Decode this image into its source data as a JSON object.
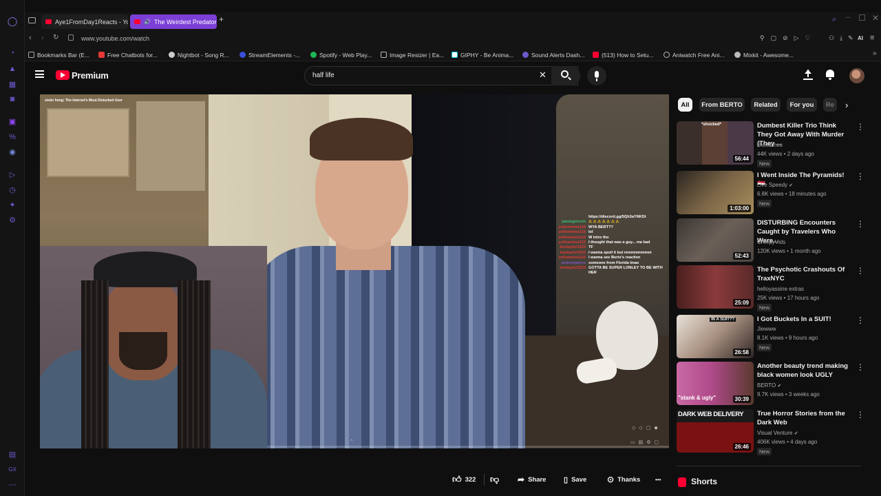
{
  "browser": {
    "tabs": [
      {
        "label": "Aye1FromDay1Reacts - Yo",
        "active": false
      },
      {
        "label": "The Weirdest Predator",
        "active": true
      }
    ],
    "new_tab": "+",
    "url": "www.youtube.com/watch",
    "ai_label": "AI",
    "bookmarks": [
      "Bookmarks Bar (E...",
      "Free Chatbots for...",
      "Nightbot - Song R...",
      "StreamElements -...",
      "Spotify - Web Play...",
      "Image Resizer | Ea...",
      "GIPHY - Be Anima...",
      "Sound Alerts Dash...",
      "(513) How to Setu...",
      "Aniwatch Free Ani...",
      "Mixkit - Awesome..."
    ]
  },
  "youtube": {
    "logo": "Premium",
    "search_value": "half life",
    "video": {
      "overlay_title": "sister hong: The Internet's Most Disturbed User",
      "chat": [
        {
          "user": "",
          "msg": "https://discord.gg/5Qh3aYNKDt"
        },
        {
          "user": "jakelagniroth",
          "msg": "⚠ ⚠ ⚠ ⚠ ⚠ ⚠ ⚠"
        },
        {
          "user": "yellowmine216",
          "msg": "WYA BERT??"
        },
        {
          "user": "yellowmine216",
          "msg": "lol"
        },
        {
          "user": "yellowmine216",
          "msg": "W intro tho"
        },
        {
          "user": "yellowmine216",
          "msg": "I thought that was a guy... ma bad"
        },
        {
          "user": "bentaylor3223",
          "msg": "TF"
        },
        {
          "user": "bentaylor3223",
          "msg": "I wanna spoil it but mmmmmmmm"
        },
        {
          "user": "yellowmine216",
          "msg": "I wanna see Berto's reaction"
        },
        {
          "user": "andrewjames",
          "msg": "someone from Florida lmao"
        },
        {
          "user": "bentaylor3223",
          "msg": "GOTTA BE SUPER LONLEY TO BE WITH HER"
        }
      ]
    },
    "chips": [
      "All",
      "From BERTO",
      "Related",
      "For you",
      "Re"
    ],
    "recommendations": [
      {
        "title": "Dumbest Killer Trio Think They Got Away With Murder (They ...",
        "channel": "Bloodlines",
        "meta": "44K views • 2 days ago",
        "badge": "New",
        "duration": "56:44",
        "thumb_text": "*shocked*",
        "verified": false
      },
      {
        "title": "I Went Inside The Pyramids! 🇪🇬",
        "channel": "Live Speedy",
        "meta": "6.8K views • 18 minutes ago",
        "badge": "New",
        "duration": "1:03:00",
        "thumb_text": "",
        "verified": true
      },
      {
        "title": "DISTURBING Encounters Caught by Travelers Who Were...",
        "channel": "CreepyVids",
        "meta": "120K views • 1 month ago",
        "badge": "",
        "duration": "52:43",
        "thumb_text": "",
        "verified": false
      },
      {
        "title": "The Psychotic Crashouts Of TraxNYC",
        "channel": "helloyassine extras",
        "meta": "25K views • 17 hours ago",
        "badge": "New",
        "duration": "25:09",
        "thumb_text": "",
        "verified": false
      },
      {
        "title": "I Got Buckets In a SUIT!",
        "channel": "Jiewww",
        "meta": "8.1K views • 9 hours ago",
        "badge": "New",
        "duration": "26:58",
        "thumb_text": "IN A SUIT??",
        "verified": false
      },
      {
        "title": "Another beauty trend making black women look UGLY",
        "channel": "BERTO",
        "meta": "9.7K views • 3 weeks ago",
        "badge": "New",
        "duration": "30:39",
        "thumb_text": "\"stank & ugly\"",
        "verified": true
      },
      {
        "title": "True Horror Stories from the Dark Web",
        "channel": "Visual Venture",
        "meta": "406K views • 4 days ago",
        "badge": "New",
        "duration": "26:46",
        "thumb_text": "DARK WEB DELIVERY",
        "verified": true
      }
    ],
    "actions": {
      "likes": "322",
      "share": "Share",
      "save": "Save",
      "thanks": "Thanks",
      "more": "•••"
    },
    "shorts_label": "Shorts"
  }
}
